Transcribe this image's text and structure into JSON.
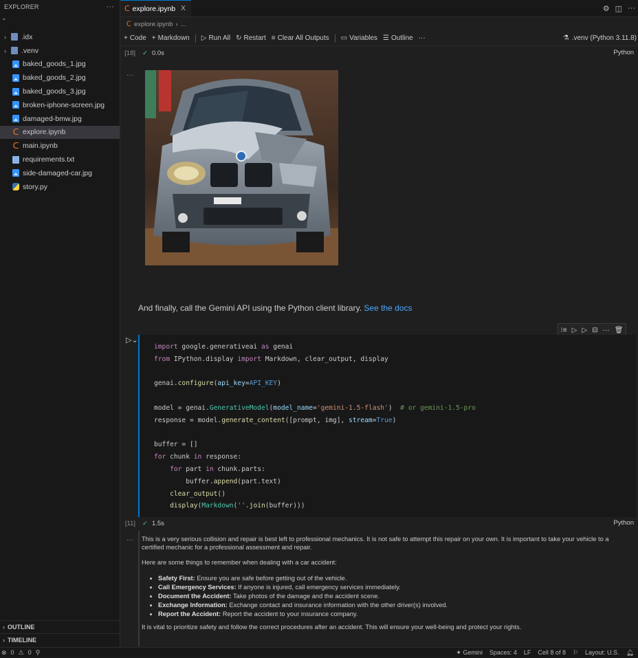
{
  "sidebar": {
    "title": "EXPLORER",
    "more": "···",
    "items": [
      {
        "label": ".idx",
        "kind": "folder"
      },
      {
        "label": ".venv",
        "kind": "folder"
      },
      {
        "label": "baked_goods_1.jpg",
        "kind": "image"
      },
      {
        "label": "baked_goods_2.jpg",
        "kind": "image"
      },
      {
        "label": "baked_goods_3.jpg",
        "kind": "image"
      },
      {
        "label": "broken-iphone-screen.jpg",
        "kind": "image"
      },
      {
        "label": "damaged-bmw.jpg",
        "kind": "image"
      },
      {
        "label": "explore.ipynb",
        "kind": "notebook",
        "active": true
      },
      {
        "label": "main.ipynb",
        "kind": "notebook"
      },
      {
        "label": "requirements.txt",
        "kind": "text"
      },
      {
        "label": "side-damaged-car.jpg",
        "kind": "image"
      },
      {
        "label": "story.py",
        "kind": "python"
      }
    ],
    "outline": "OUTLINE",
    "timeline": "TIMELINE"
  },
  "tab": {
    "label": "explore.ipynb",
    "close": "X"
  },
  "breadcrumb": {
    "file": "explore.ipynb",
    "rest": "..."
  },
  "toolbar": {
    "code": "Code",
    "markdown": "Markdown",
    "run_all": "Run All",
    "restart": "Restart",
    "clear": "Clear All Outputs",
    "variables": "Variables",
    "outline": "Outline",
    "more": "···",
    "kernel": ".venv (Python 3.11.8)"
  },
  "cell1": {
    "count": "[18]",
    "time": "0.0s",
    "lang": "Python"
  },
  "markdown": {
    "text": "And finally, call the Gemini API using the Python client library.",
    "link": "See the docs"
  },
  "cell2": {
    "count": "[11]",
    "time": "1.5s",
    "lang": "Python"
  },
  "output": {
    "intro": "This is a very serious collision and repair is best left to professional mechanics. It is not safe to attempt this repair on your own. It is important to take your vehicle to a certified mechanic for a professional assessment and repair.",
    "list_intro": "Here are some things to remember when dealing with a car accident:",
    "bullets": [
      {
        "head": "Safety First:",
        "text": "Ensure you are safe before getting out of the vehicle."
      },
      {
        "head": "Call Emergency Services:",
        "text": "If anyone is injured, call emergency services immediately."
      },
      {
        "head": "Document the Accident:",
        "text": "Take photos of the damage and the accident scene."
      },
      {
        "head": "Exchange Information:",
        "text": "Exchange contact and insurance information with the other driver(s) involved."
      },
      {
        "head": "Report the Accident:",
        "text": "Report the accident to your insurance company."
      }
    ],
    "closing": "It is vital to prioritize safety and follow the correct procedures after an accident. This will ensure your well-being and protect your rights."
  },
  "status": {
    "errors": "0",
    "warnings": "0",
    "gemini": "Gemini",
    "spaces": "Spaces: 4",
    "eol": "LF",
    "cell": "Cell 8 of 8",
    "layout": "Layout: U.S."
  }
}
